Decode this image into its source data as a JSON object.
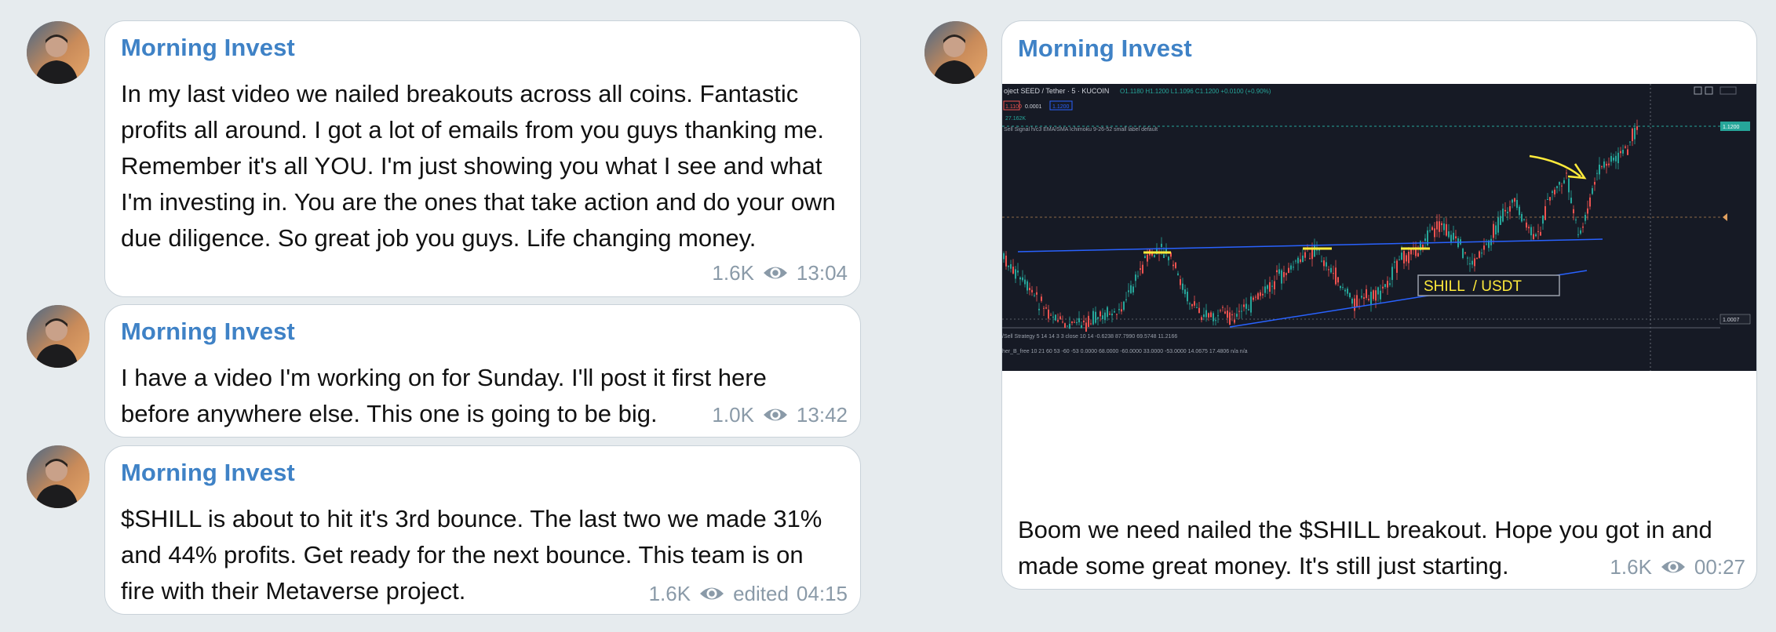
{
  "messages": [
    {
      "sender": "Morning Invest",
      "text": "In my last video we nailed breakouts across all coins. Fantastic profits all around. I got a lot of emails from you guys thanking me. Remember it's all YOU. I'm just showing you what I see and what I'm investing in. You are the ones that take action and do your own due diligence. So great job you guys. Life changing money.",
      "views": "1.6K",
      "time": "13:04"
    },
    {
      "sender": "Morning Invest",
      "text": "I have a video I'm working on for Sunday. I'll post it first here before anywhere else. This one is going to be big.",
      "views": "1.0K",
      "time": "13:42"
    },
    {
      "sender": "Morning Invest",
      "text": "$SHILL is about to hit it's 3rd bounce. The last two we made 31% and 44% profits. Get ready for the next bounce. This team is on fire with their Metaverse project.",
      "views": "1.6K",
      "edited": "edited",
      "time": "04:15"
    },
    {
      "sender": "Morning Invest",
      "text": "Boom we need nailed the $SHILL breakout. Hope you got in and made some great money. It's still just starting.",
      "views": "1.6K",
      "time": "00:27",
      "chart_image": {
        "header": "oject SEED / Tether · 5 · KUCOIN",
        "ohlc": "O1.1180 H1.1200 L1.1096 C1.1200 +0.0100 (+0.90%)",
        "badge_1": "1.1100",
        "badge_2": "1.1200",
        "vol_label": "27.162K",
        "indicator_label": "Sell Signal h/c3 EMA/SMA Ichimoku 9-26-52 small label default",
        "price_tag_top": "1.1200",
        "price_tag_mid": "1.0007",
        "pair_label": "SHILL  / USDT",
        "strategy_line": "/Sell Strategy 5 14 14 3 3 close 10 14  -0.6238  87.7990  69.5748  11.2166",
        "osc_line": "her_B_free 10 21 60 53 -60 -53  0.0000  68.0000  -60.0000  33.0000  -53.0000  14.0675  17.4806  n/a  n/a",
        "colors": {
          "background": "#161a25",
          "up_candle": "#26a69a",
          "down_candle": "#ef5350",
          "trend_line": "#2962ff",
          "annotation_yellow": "#ffeb3b"
        }
      }
    }
  ],
  "icons": {
    "views": "eye-icon",
    "avatar": "profile-photo"
  }
}
